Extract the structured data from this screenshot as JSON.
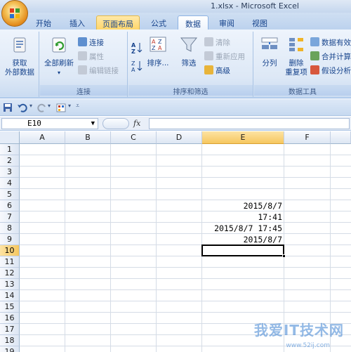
{
  "window": {
    "title": "1.xlsx - Microsoft Excel"
  },
  "tabs": [
    {
      "label": "开始"
    },
    {
      "label": "插入"
    },
    {
      "label": "页面布局"
    },
    {
      "label": "公式"
    },
    {
      "label": "数据"
    },
    {
      "label": "审阅"
    },
    {
      "label": "视图"
    }
  ],
  "ribbon": {
    "get_external": {
      "line1": "获取",
      "line2": "外部数据"
    },
    "connections": {
      "refresh_all": "全部刷新",
      "connections": "连接",
      "properties": "属性",
      "edit_links": "编辑链接",
      "label": "连接"
    },
    "sort_filter": {
      "sort": "排序...",
      "filter": "筛选",
      "clear": "清除",
      "reapply": "重新应用",
      "advanced": "高级",
      "label": "排序和筛选"
    },
    "data_tools": {
      "split": "分列",
      "remove_dup_l1": "删除",
      "remove_dup_l2": "重复项",
      "validation": "数据有效",
      "consolidate": "合并计算",
      "whatif": "假设分析",
      "label": "数据工具"
    }
  },
  "formula_bar": {
    "name_box": "E10",
    "fx": "fx",
    "formula": ""
  },
  "columns": [
    "A",
    "B",
    "C",
    "D",
    "E",
    "F"
  ],
  "rows": [
    "1",
    "2",
    "3",
    "4",
    "5",
    "6",
    "7",
    "8",
    "9",
    "10",
    "11",
    "12",
    "13",
    "14",
    "15",
    "16",
    "17",
    "18",
    "19"
  ],
  "cells": {
    "E6": "2015/8/7",
    "E7": "17:41",
    "E8": "2015/8/7 17:45",
    "E9": "2015/8/7"
  },
  "watermark": {
    "text": "我爱IT技术网",
    "url": "www.52ij.com"
  },
  "colors": {
    "accent": "#15428b",
    "selected_header": "#f6c75f"
  }
}
